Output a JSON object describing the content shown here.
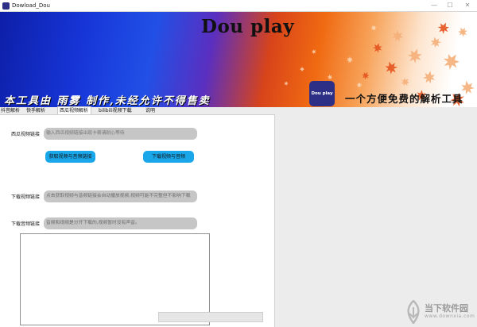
{
  "window": {
    "title": "Dowload_Dou",
    "controls": {
      "minimize": "—",
      "maximize": "☐",
      "close": "✕"
    }
  },
  "banner": {
    "title": "Dou play",
    "slogan": "本工具由 雨雾 制作,未经允许不得售卖",
    "logo_text": "Dou play",
    "tagline": "一个方便免费的解析工具"
  },
  "tabs": [
    {
      "label": "抖音解析"
    },
    {
      "label": "快手解析"
    },
    {
      "label": "西瓜视频解析"
    },
    {
      "label": "bilibili视频下载"
    },
    {
      "label": "说明"
    }
  ],
  "form": {
    "xigua_link_label": "西瓜视频链接",
    "xigua_link_placeholder": "输入西瓜视频链接出现卡顿请耐心等待",
    "get_links_button": "获取视频与音频链接",
    "download_button": "下载视频与音频",
    "video_link_label": "下载视频链接",
    "video_link_value": "点击获取视频与音频链接会自动播放视频,视频可能不完整但不影响下载",
    "audio_link_label": "下载音频链接",
    "audio_link_value": "音频和视频是分开下载的,视频暂时没有声音。"
  },
  "watermark": {
    "text": "当下软件园",
    "sub": "www.downxia.com"
  }
}
